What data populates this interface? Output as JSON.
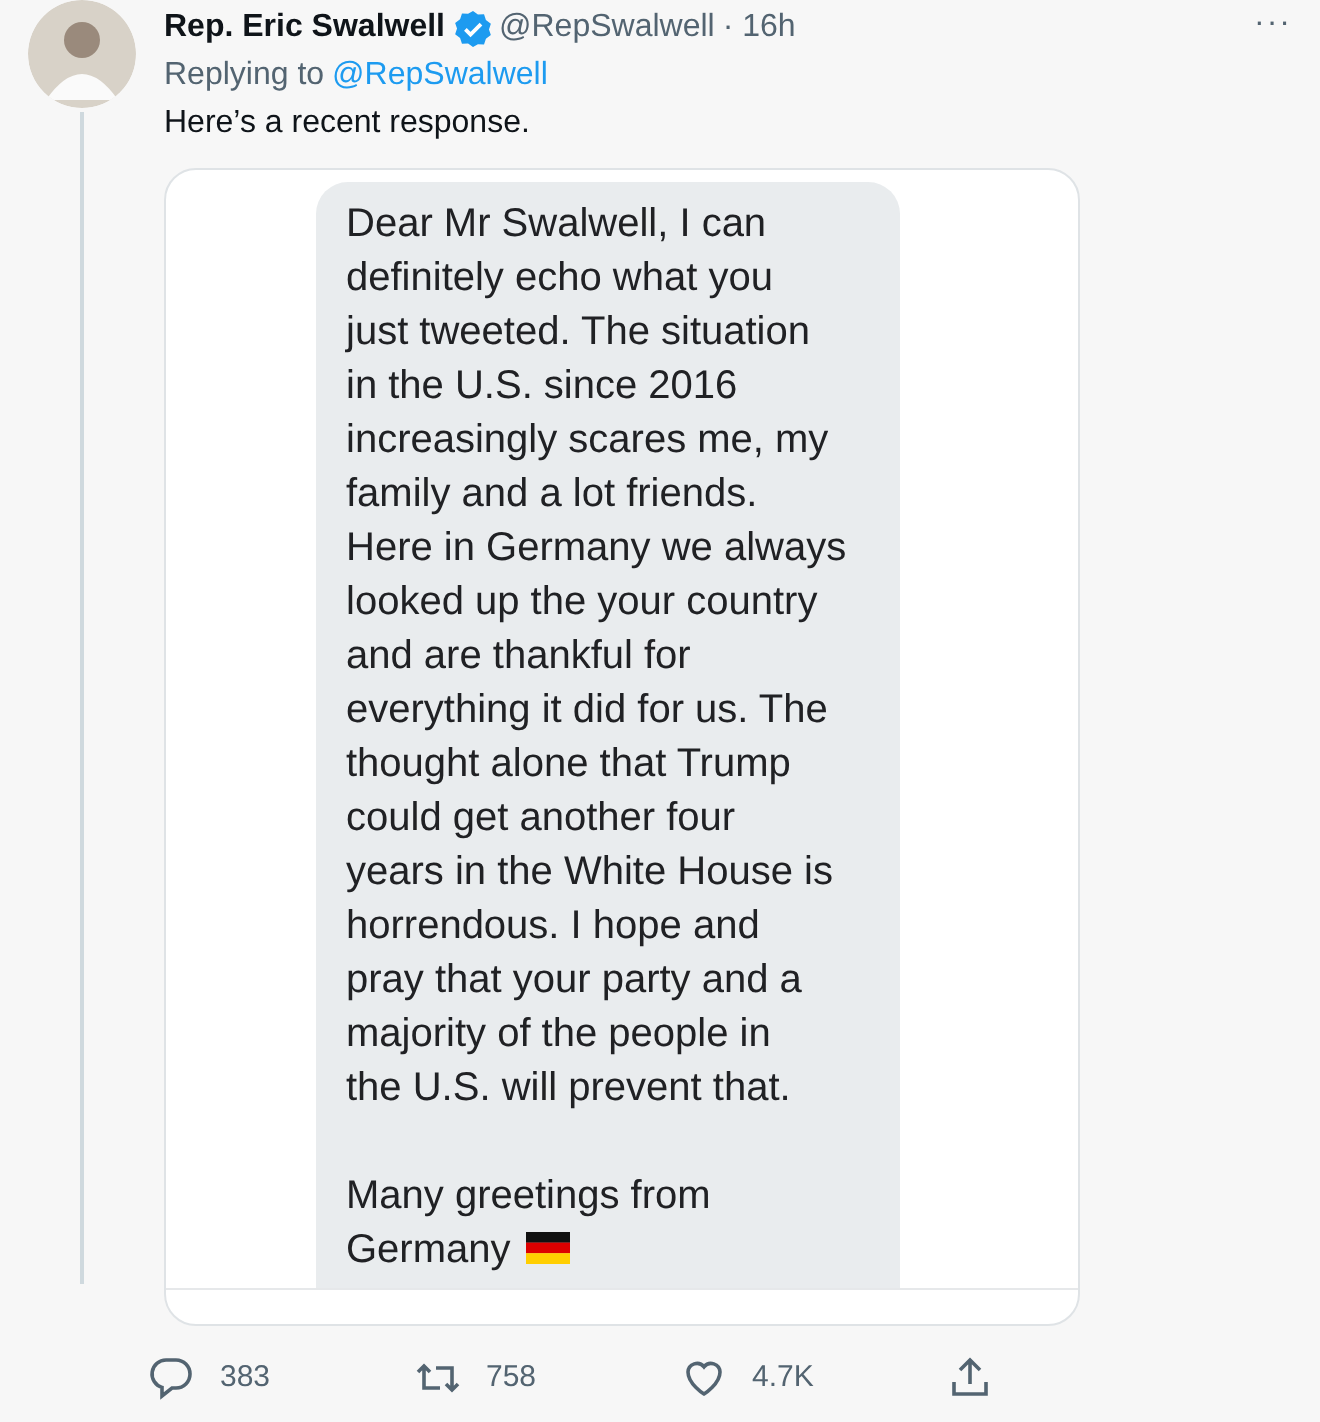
{
  "tweet": {
    "author": "Rep. Eric Swalwell",
    "verified": true,
    "handle": "@RepSwalwell",
    "time": "· 16h",
    "more": "···",
    "replying_label": "Replying to",
    "replying_to": "@RepSwalwell",
    "text": "Here’s a recent response."
  },
  "message": {
    "paragraphs": [
      {
        "lines": [
          "Dear Mr Swalwell, I can",
          "definitely echo what you",
          "just tweeted. The situation",
          "in the U.S. since 2016",
          "increasingly scares me, my",
          "family and a lot friends.",
          "Here in Germany we always",
          "looked up the your country",
          "and are thankful for",
          "everything it did for us. The",
          "thought alone that Trump",
          "could get another four",
          "years in the White House is",
          "horrendous. I hope and",
          "pray that your party and a",
          "majority of the people in",
          "the U.S. will prevent that."
        ]
      },
      {
        "lines": [
          "Many greetings from",
          "Germany"
        ],
        "flag": true
      }
    ]
  },
  "actions": [
    {
      "kind": "reply",
      "count": "383"
    },
    {
      "kind": "retweet",
      "count": "758"
    },
    {
      "kind": "like",
      "count": "4.7K"
    },
    {
      "kind": "share"
    }
  ]
}
